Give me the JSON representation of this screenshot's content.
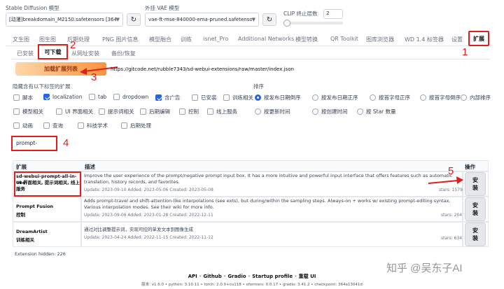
{
  "model": {
    "label": "Stable Diffusion 模型",
    "value": "[动漫]breakdomain_M2150.safetensors [364a13"
  },
  "vae": {
    "label": "外挂 VAE 模型",
    "value": "vae-ft-mse-840000-ema-pruned.safetensors"
  },
  "clip": {
    "label": "CLIP 终止层数",
    "value": "2",
    "fraction": 0.0
  },
  "main_tabs": [
    "文生图",
    "图生图",
    "后期处理",
    "PNG 图片信息",
    "模型融合",
    "训练",
    "isnet_Pro",
    "Additional Networks",
    "模型转换",
    "QR Toolkit",
    "图库浏览器",
    "WD 1.4 标签器",
    "设置",
    "扩展"
  ],
  "sub_tabs": [
    "已安装",
    "可下载",
    "从网址安装",
    "备份/恢复"
  ],
  "load_button": "加载扩展列表",
  "index_url": "https://gitcode.net/rubble7343/sd-webui-extensions/raw/master/index.json",
  "filter_label": "隐藏含有以下标签的扩展",
  "filters": [
    {
      "label": "脚本",
      "checked": false
    },
    {
      "label": "localization",
      "checked": true
    },
    {
      "label": "tab",
      "checked": false
    },
    {
      "label": "dropdown",
      "checked": false
    },
    {
      "label": "含广告",
      "checked": true
    },
    {
      "label": "已安装",
      "checked": false
    },
    {
      "label": "训练相关",
      "checked": false
    },
    {
      "label": "模型相关",
      "checked": false
    },
    {
      "label": "UI 界面相关",
      "checked": false
    },
    {
      "label": "提示词相关",
      "checked": false
    },
    {
      "label": "后期编辑",
      "checked": false
    },
    {
      "label": "控制",
      "checked": false
    },
    {
      "label": "线上服务",
      "checked": false
    },
    {
      "label": "动画",
      "checked": false
    },
    {
      "label": "查询",
      "checked": false
    },
    {
      "label": "科技学术",
      "checked": false
    },
    {
      "label": "后期处理",
      "checked": false
    }
  ],
  "sort_label": "排序",
  "sorts": [
    {
      "label": "按发布日期倒序",
      "checked": true
    },
    {
      "label": "按发布日期正序",
      "checked": false
    },
    {
      "label": "按首字母正序",
      "checked": false
    },
    {
      "label": "按首字母倒序",
      "checked": false
    },
    {
      "label": "内部排序",
      "checked": false
    },
    {
      "label": "按更新时间",
      "checked": false
    },
    {
      "label": "按创建时间",
      "checked": false
    },
    {
      "label": "按 Star 数量",
      "checked": false
    }
  ],
  "search_value": "prompt-",
  "table": {
    "headers": [
      "扩展",
      "描述",
      "操作"
    ],
    "rows": [
      {
        "name": "sd-webui-prompt-all-in-one",
        "tags": "UI 界面相关, 提示词相关, 线上服务",
        "desc": "Improve the user experience of the prompt/negative prompt input box. It has a more intuitive and powerful input interface that offers features such as automatic translation, history records, and favorites.",
        "meta": "Update: 2023-09-10 Added: 2023-05-06 Created: 2023-05-08",
        "stars": "stars: 1579",
        "action": "安装"
      },
      {
        "name": "Prompt Fusion",
        "tags": "控制",
        "desc": "Adds prompt-travel and shift-attention-like interpolations (see exts), but during/within the sampling steps. Always-on + works w/ existing prompt-editing syntax. Various interpolation modes. See their wiki for more info.",
        "meta": "Update: 2023-09-06 Added: 2023-01-28 Created: 2022-12-11",
        "stars": "stars: 204",
        "action": "安装"
      },
      {
        "name": "DreamArtist",
        "tags": "训练相关",
        "desc": "通过对比调整提示词，实现可控的单发文本到图像生成",
        "meta": "Update: 2023-04-24 Added: 2022-11-15 Created: 2022-11-12",
        "stars": "stars: 634",
        "action": "安装"
      }
    ]
  },
  "hidden_count": "Extension hidden: 226",
  "footer_links": [
    "API",
    "Github",
    "Gradio",
    "Startup profile",
    "重载 UI"
  ],
  "footer_info": "版本: v1.6.0  •  python: 3.10.11  •  torch: 2.0.0+cu118  •  xformers: 0.0.17  •  gradio: 3.41.2  •  checkpoint: 364a13041d",
  "watermark": "知乎 @吴东子AI",
  "annotations": [
    "1",
    "2",
    "3",
    "4",
    "5"
  ],
  "colors": {
    "accent": "#f97316",
    "primary": "#2563eb",
    "annotation": "#e11d1d"
  }
}
